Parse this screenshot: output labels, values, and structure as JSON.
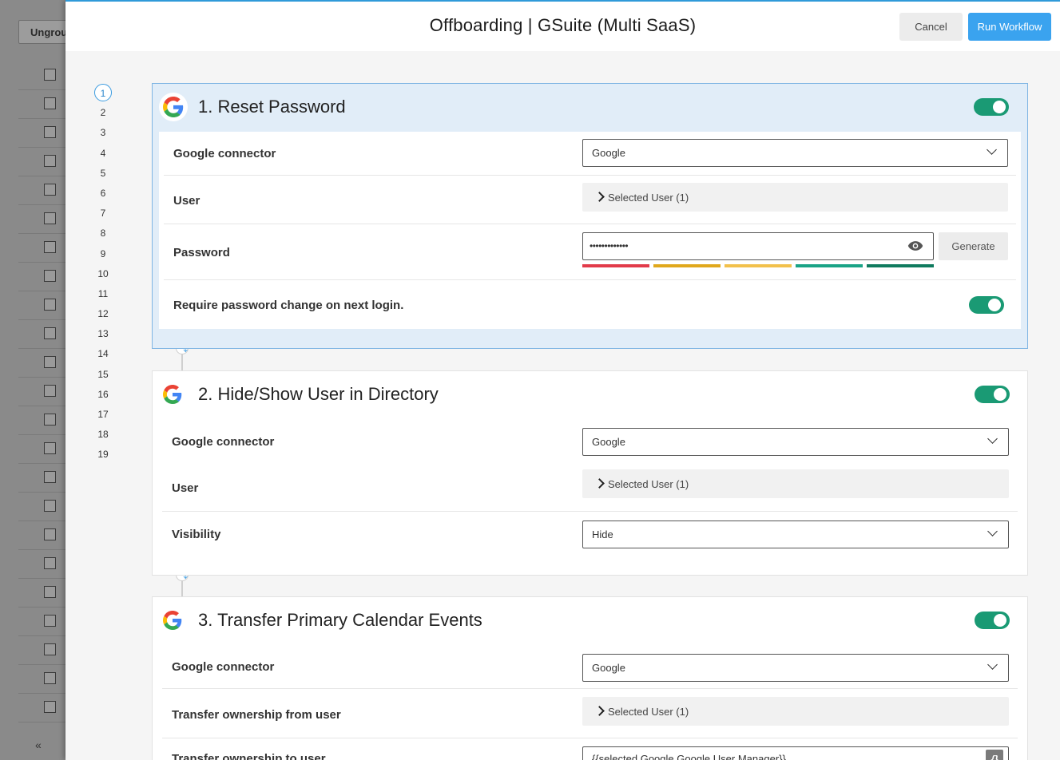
{
  "background": {
    "ungroup_label": "Ungrou",
    "row_count": 23,
    "collapse_icon": "«"
  },
  "header": {
    "title": "Offboarding | GSuite (Multi SaaS)",
    "cancel_label": "Cancel",
    "run_label": "Run Workflow"
  },
  "steps": [
    "1",
    "2",
    "3",
    "4",
    "5",
    "6",
    "7",
    "8",
    "9",
    "10",
    "11",
    "12",
    "13",
    "14",
    "15",
    "16",
    "17",
    "18",
    "19"
  ],
  "cards": [
    {
      "title": "1. Reset Password",
      "enabled": true,
      "connector_label": "Google connector",
      "connector_value": "Google",
      "user_label": "User",
      "user_value": "Selected User (1)",
      "password_label": "Password",
      "password_mask": "•••••••••••••",
      "generate_label": "Generate",
      "require_label": "Require password change on next login.",
      "require_enabled": true
    },
    {
      "title": "2. Hide/Show User in Directory",
      "enabled": true,
      "connector_label": "Google connector",
      "connector_value": "Google",
      "user_label": "User",
      "user_value": "Selected User (1)",
      "visibility_label": "Visibility",
      "visibility_value": "Hide"
    },
    {
      "title": "3. Transfer Primary Calendar Events",
      "enabled": true,
      "connector_label": "Google connector",
      "connector_value": "Google",
      "from_label": "Transfer ownership from user",
      "from_value": "Selected User (1)",
      "to_label": "Transfer ownership to user",
      "to_value": "{{selected.Google.Google User Manager}}"
    }
  ],
  "colors": {
    "accent": "#3aa3ef",
    "toggle_on": "#1a9a74",
    "strength": [
      "#e23b4a",
      "#e0a81c",
      "#f2c14c",
      "#1aa386",
      "#0f7a5e"
    ]
  }
}
